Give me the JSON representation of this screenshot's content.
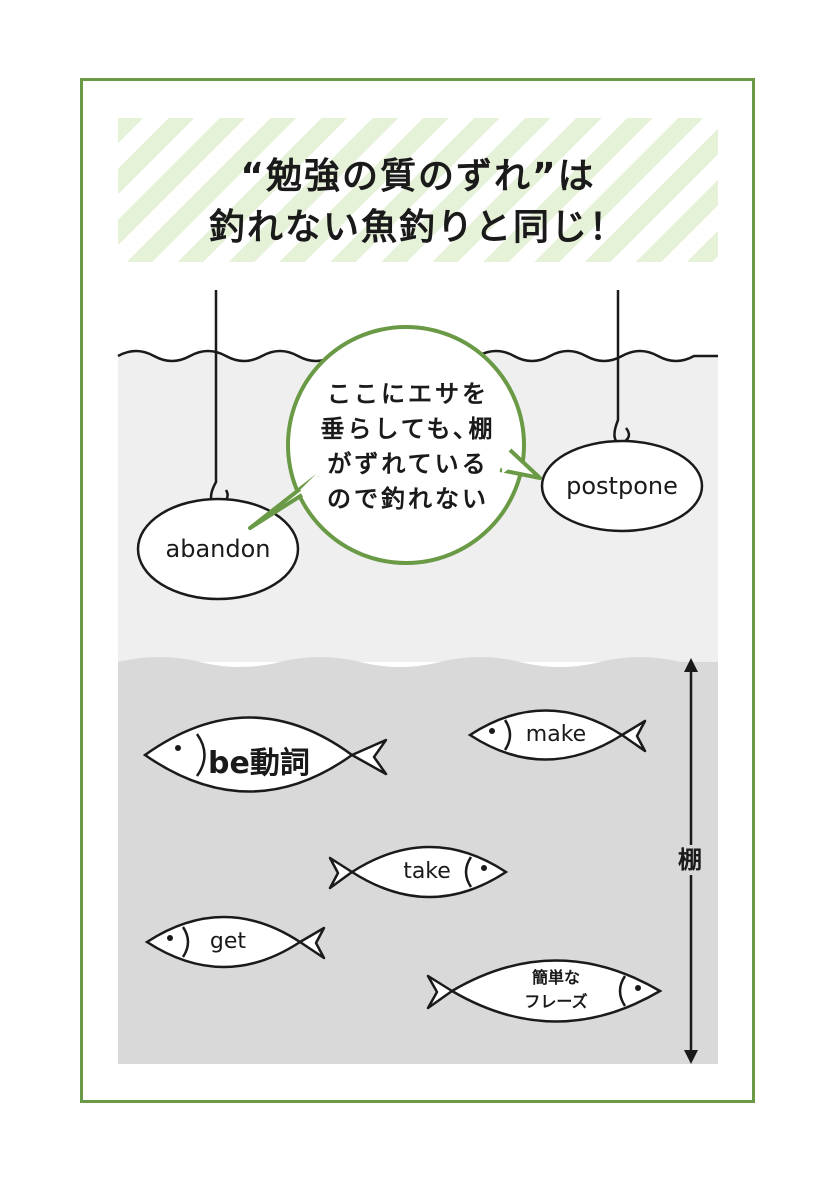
{
  "title": {
    "line1": "“勉強の質のずれ”は",
    "line2": "釣れない魚釣りと同じ！"
  },
  "speech_bubble": {
    "lines": [
      "ここにエサを",
      "垂らしても､棚",
      "がずれている",
      "ので釣れない"
    ]
  },
  "baits": {
    "left": "abandon",
    "right": "postpone"
  },
  "depth_label": "棚",
  "fish": {
    "be_verb": "be動詞",
    "make": "make",
    "take": "take",
    "get": "get",
    "easy_phrase_line1": "簡単な",
    "easy_phrase_line2": "フレーズ"
  },
  "colors": {
    "frame_green": "#6a9a45",
    "stripe_green": "#e6f2d8",
    "shallow_water": "#efefef",
    "deep_water": "#d9d9d9",
    "ink": "#1a1a1a"
  }
}
